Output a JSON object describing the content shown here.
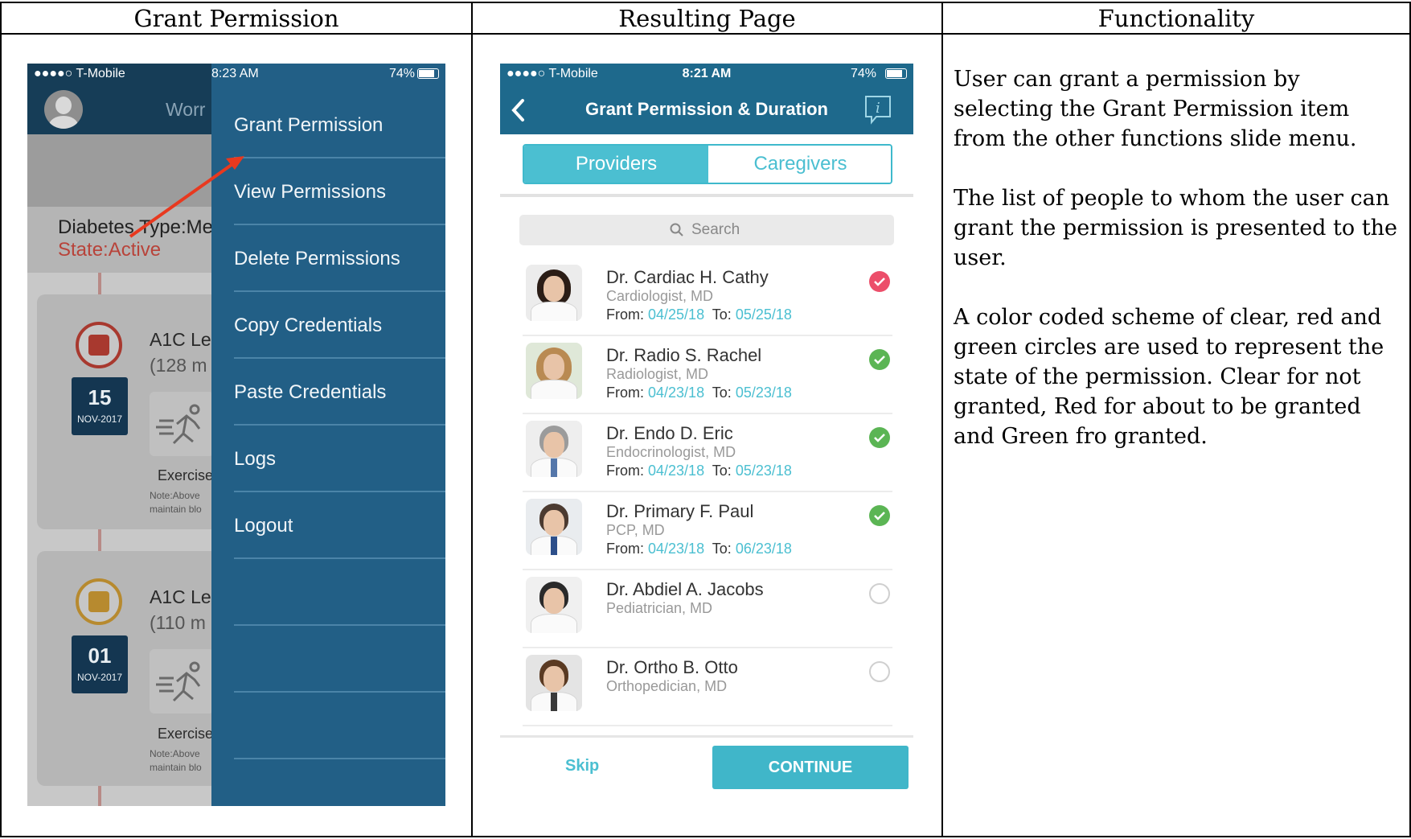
{
  "headers": {
    "col1": "Grant Permission",
    "col2": "Resulting Page",
    "col3": "Functionality"
  },
  "phone1": {
    "status": {
      "signal": "●●●●○ T-Mobile",
      "time": "8:23 AM",
      "battery": "74%"
    },
    "header_text": "Worr",
    "diabetes_line": "Diabetes Type:Me",
    "state_line": "State:Active",
    "timeline": [
      {
        "title": "A1C Le",
        "value": "(128 m",
        "day": "15",
        "month": "NOV-2017",
        "exercise": "Exercise",
        "note1": "Note:Above",
        "note2": "maintain blo",
        "icon": "alert-icon",
        "color": "#a8392f"
      },
      {
        "title": "A1C Le",
        "value": "(110 m",
        "day": "01",
        "month": "NOV-2017",
        "exercise": "Exercise",
        "note1": "Note:Above",
        "note2": "maintain blo",
        "icon": "warning-icon",
        "color": "#b78a2f"
      }
    ],
    "menu": [
      "Grant Permission",
      "View Permissions",
      "Delete Permissions",
      "Copy Credentials",
      "Paste Credentials",
      "Logs",
      "Logout",
      "",
      "",
      ""
    ],
    "arrow_color": "#e8391f"
  },
  "phone2": {
    "status": {
      "signal": "●●●●○ T-Mobile",
      "time": "8:21 AM",
      "battery": "74%"
    },
    "title": "Grant Permission & Duration",
    "tabs": {
      "active": "Providers",
      "inactive": "Caregivers"
    },
    "search_placeholder": "Search",
    "from_label": "From:",
    "to_label": "To:",
    "doctors": [
      {
        "name": "Dr. Cardiac H. Cathy",
        "specialty": "Cardiologist, MD",
        "from": "04/25/18",
        "to": "05/25/18",
        "state": "red"
      },
      {
        "name": "Dr. Radio S. Rachel",
        "specialty": "Radiologist, MD",
        "from": "04/23/18",
        "to": "05/23/18",
        "state": "green"
      },
      {
        "name": "Dr. Endo D. Eric",
        "specialty": "Endocrinologist, MD",
        "from": "04/23/18",
        "to": "05/23/18",
        "state": "green"
      },
      {
        "name": "Dr. Primary F. Paul",
        "specialty": "PCP, MD",
        "from": "04/23/18",
        "to": "06/23/18",
        "state": "green"
      },
      {
        "name": "Dr. Abdiel A. Jacobs",
        "specialty": "Pediatrician, MD",
        "state": "clear"
      },
      {
        "name": "Dr. Ortho B. Otto",
        "specialty": "Orthopedician, MD",
        "state": "clear"
      }
    ],
    "skip": "Skip",
    "continue": "CONTINUE",
    "colors": {
      "nav": "#1e698c",
      "accent": "#4bbfd1",
      "red": "#ec4e6a",
      "green": "#5bb554"
    }
  },
  "functionality": [
    "User can grant a permission by selecting the Grant Permission item from the other functions slide menu.",
    "The list of people to whom the user can grant the permission is presented to the user.",
    "A color coded scheme of clear, red and green circles are used to represent the state of the permission.  Clear for not granted, Red for about to be granted and Green fro granted."
  ]
}
